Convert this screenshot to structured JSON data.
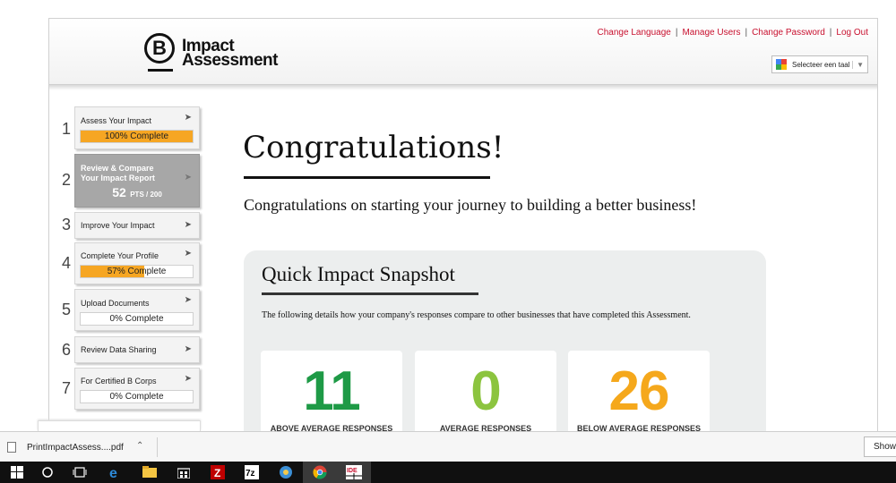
{
  "header": {
    "logo_letter": "B",
    "logo_line1": "Impact",
    "logo_line2": "Assessment",
    "links": [
      "Change Language",
      "Manage Users",
      "Change Password",
      "Log Out"
    ],
    "translate_label": "Selecteer een taal",
    "translate_caret": "▼"
  },
  "steps": [
    {
      "num": "1",
      "label": "Assess Your Impact",
      "progress_text": "100% Complete",
      "progress": 1.0
    },
    {
      "num": "2",
      "label_line1": "Review & Compare",
      "label_line2": "Your Impact Report",
      "points": "52",
      "points_suffix": "PTS / 200"
    },
    {
      "num": "3",
      "label": "Improve Your Impact"
    },
    {
      "num": "4",
      "label": "Complete Your Profile",
      "progress_text": "57% Complete",
      "progress": 0.57
    },
    {
      "num": "5",
      "label": "Upload Documents",
      "progress_text": "0% Complete",
      "progress": 0
    },
    {
      "num": "6",
      "label": "Review Data Sharing"
    },
    {
      "num": "7",
      "label": "For Certified B Corps",
      "progress_text": "0% Complete",
      "progress": 0
    }
  ],
  "main": {
    "title": "Congratulations!",
    "subtitle": "Congratulations on starting your journey to building a better business!"
  },
  "snapshot": {
    "title": "Quick Impact Snapshot",
    "description": "The following details how your company's responses compare to other businesses that have completed this Assessment.",
    "stats": [
      {
        "value": "11",
        "caption": "ABOVE AVERAGE RESPONSES",
        "color": "#1e9a46"
      },
      {
        "value": "0",
        "caption": "AVERAGE RESPONSES",
        "color": "#8cc43f"
      },
      {
        "value": "26",
        "caption": "BELOW AVERAGE RESPONSES",
        "color": "#f5a81c"
      }
    ]
  },
  "downloads": {
    "file_name": "PrintImpactAssess....pdf",
    "show_all": "Show"
  },
  "colors": {
    "link_red": "#c8102e",
    "progress_orange": "#f6a623",
    "active_step_gray": "#a7a7a7"
  },
  "taskbar_icons": [
    "windows-icon",
    "search-circle-icon",
    "task-view-icon",
    "edge-icon",
    "file-explorer-icon",
    "store-icon",
    "filezilla-icon",
    "7zip-icon",
    "network-icon",
    "chrome-icon",
    "ide-icon"
  ]
}
